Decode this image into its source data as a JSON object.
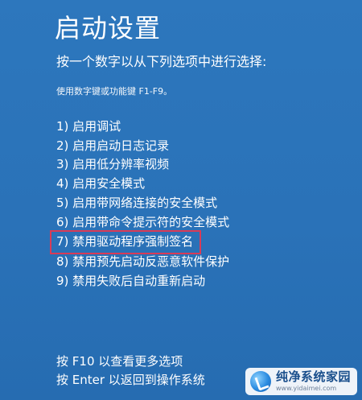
{
  "screen": {
    "title": "启动设置",
    "subtitle": "按一个数字以从下列选项中进行选择:",
    "hint": "使用数字键或功能键 F1-F9。"
  },
  "options": [
    {
      "label": "1) 启用调试"
    },
    {
      "label": "2) 启用启动日志记录"
    },
    {
      "label": "3) 启用低分辨率视频"
    },
    {
      "label": "4) 启用安全模式"
    },
    {
      "label": "5) 启用带网络连接的安全模式"
    },
    {
      "label": "6) 启用带命令提示符的安全模式"
    },
    {
      "label": "7) 禁用驱动程序强制签名",
      "highlighted": true
    },
    {
      "label": "8) 禁用预先启动反恶意软件保护"
    },
    {
      "label": "9) 禁用失败后自动重新启动"
    }
  ],
  "footer": {
    "more_options": "按 F10 以查看更多选项",
    "return_os": "按 Enter 以返回到操作系统"
  },
  "watermark": {
    "title": "纯净系统家园",
    "url": "www.yidaimei.com"
  },
  "colors": {
    "background": "#2b73b8",
    "text": "#ffffff",
    "highlight_border": "#d93b57"
  }
}
